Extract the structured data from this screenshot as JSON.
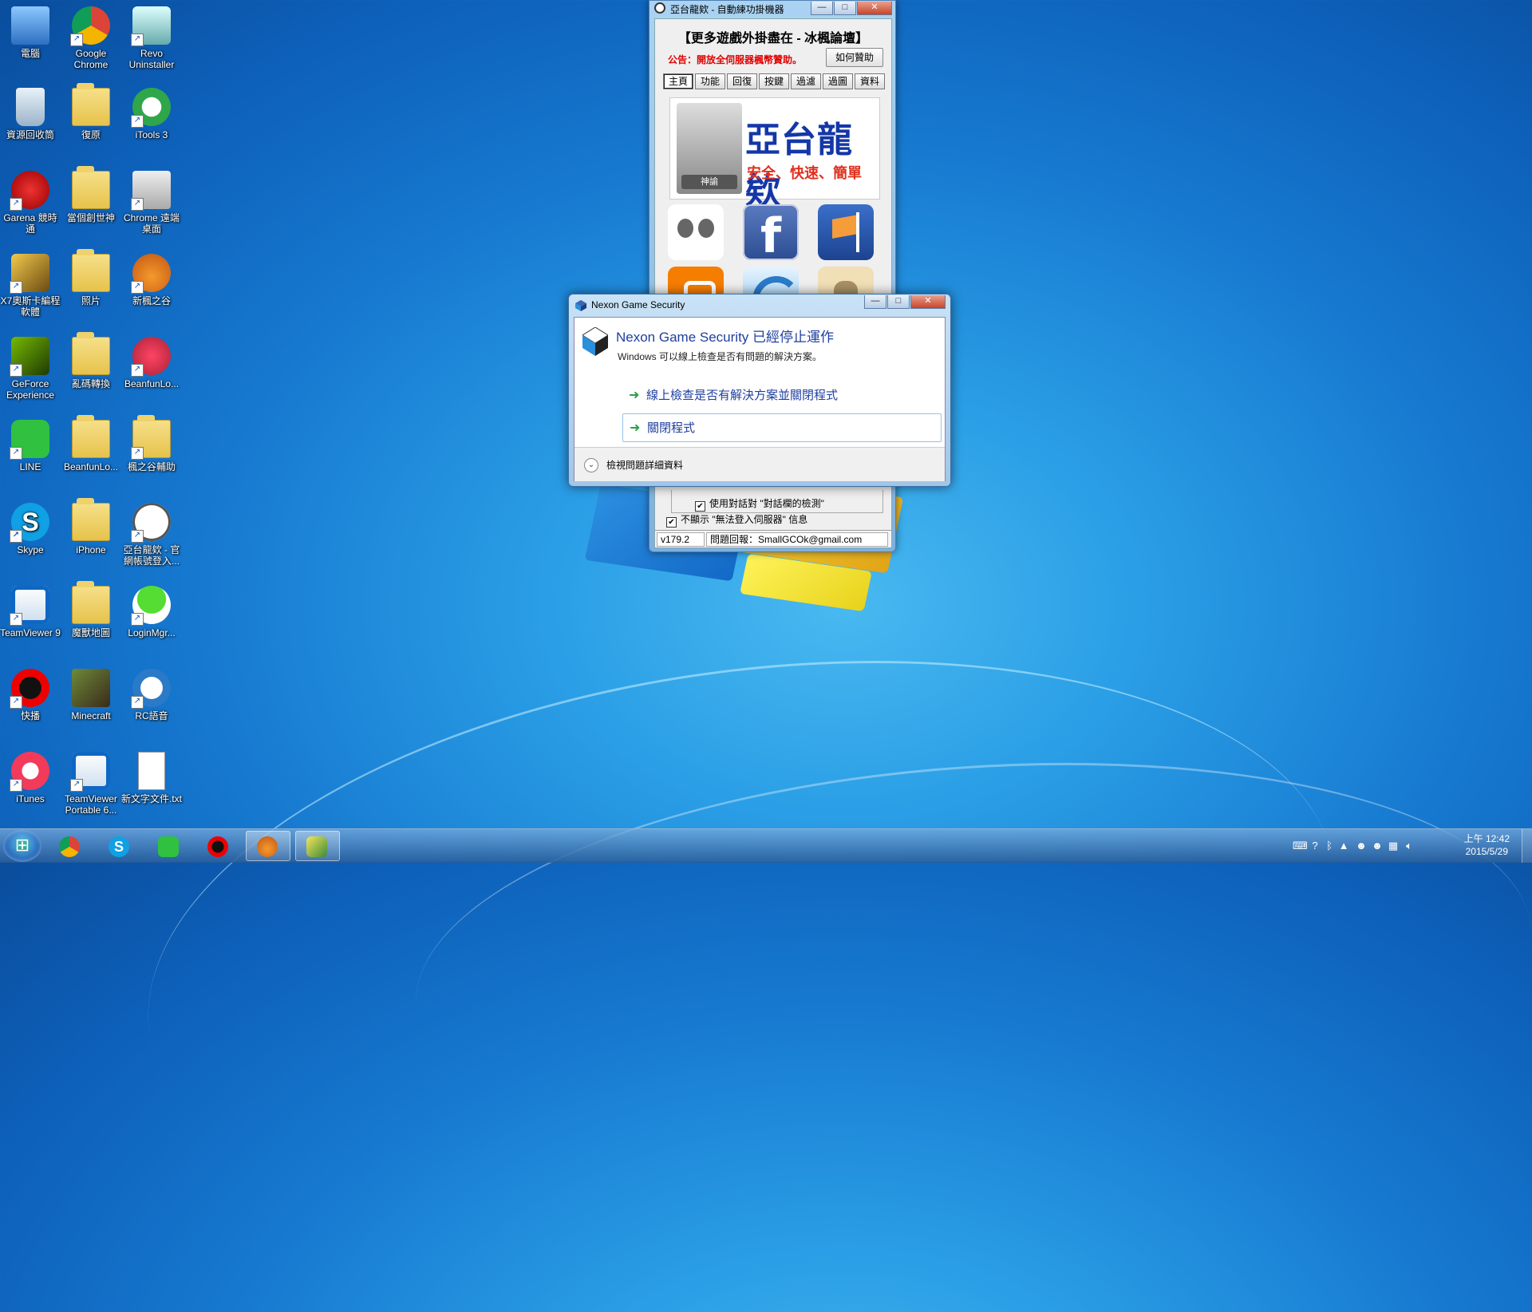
{
  "desktop": {
    "icons": [
      {
        "label": "電腦"
      },
      {
        "label": "Google Chrome"
      },
      {
        "label": "Revo Uninstaller"
      },
      {
        "label": "資源回收筒"
      },
      {
        "label": "復原"
      },
      {
        "label": "iTools 3"
      },
      {
        "label": "Garena 競時通"
      },
      {
        "label": "當個創世神"
      },
      {
        "label": "Chrome 遠端桌面"
      },
      {
        "label": "X7奧斯卡編程軟體"
      },
      {
        "label": "照片"
      },
      {
        "label": "新楓之谷"
      },
      {
        "label": "GeForce Experience"
      },
      {
        "label": "亂碼轉換"
      },
      {
        "label": "BeanfunLo..."
      },
      {
        "label": "LINE"
      },
      {
        "label": "BeanfunLo..."
      },
      {
        "label": "楓之谷輔助"
      },
      {
        "label": "Skype"
      },
      {
        "label": "iPhone"
      },
      {
        "label": "亞台龍欸 - 官網帳號登入..."
      },
      {
        "label": "TeamViewer 9"
      },
      {
        "label": "魔獸地圖"
      },
      {
        "label": "LoginMgr..."
      },
      {
        "label": "快播"
      },
      {
        "label": "Minecraft"
      },
      {
        "label": "RC語音"
      },
      {
        "label": "iTunes"
      },
      {
        "label": "TeamViewer Portable 6..."
      },
      {
        "label": "新文字文件.txt"
      }
    ]
  },
  "app_window": {
    "title": "亞台龍欸 - 自動練功掛機器",
    "header": "【更多遊戲外掛盡在 - 冰楓論壇】",
    "notice": "公告：開放全伺服器楓幣贊助。",
    "help_button": "如何贊助",
    "tabs": [
      "主頁",
      "功能",
      "回復",
      "按鍵",
      "過濾",
      "過圖",
      "資料"
    ],
    "banner": {
      "title": "亞台龍欸",
      "slogan": "安全、快速、簡單",
      "char_label": "神諭"
    },
    "tile_f": "f",
    "checkbox1": {
      "label": "使用對話對 \"對話欄的檢測\"",
      "checked": true
    },
    "checkbox2": {
      "label": "不顯示 \"無法登入伺服器\" 信息",
      "checked": true
    },
    "version": "v179.2",
    "contact": "問題回報：SmallGCOk@gmail.com"
  },
  "dialog": {
    "title": "Nexon Game Security",
    "heading": "Nexon Game Security 已經停止運作",
    "subtext": "Windows 可以線上檢查是否有問題的解決方案。",
    "option1": "線上檢查是否有解決方案並關閉程式",
    "option2": "關閉程式",
    "details": "檢視問題詳細資料"
  },
  "window_controls": {
    "minimize": "—",
    "maximize": "□",
    "close": "✕"
  },
  "taskbar": {
    "clock_time": "上午 12:42",
    "clock_date": "2015/5/29"
  },
  "colors": {
    "dialog_link": "#1e3f9e",
    "notice": "#e00000",
    "wallpaper": "#1678cf"
  }
}
